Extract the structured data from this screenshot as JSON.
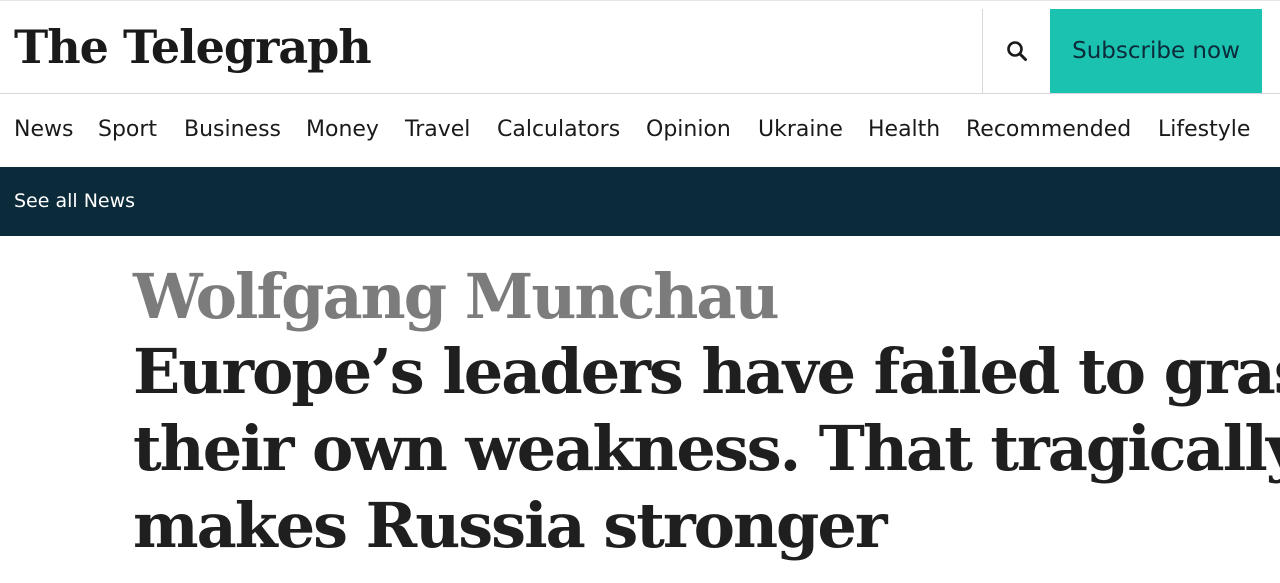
{
  "header": {
    "logo_text": "The Telegraph",
    "search_icon": "search-icon",
    "subscribe_label": "Subscribe now"
  },
  "nav": {
    "items": [
      {
        "label": "News"
      },
      {
        "label": "Sport"
      },
      {
        "label": "Business"
      },
      {
        "label": "Money"
      },
      {
        "label": "Travel"
      },
      {
        "label": "Calculators"
      },
      {
        "label": "Opinion"
      },
      {
        "label": "Ukraine"
      },
      {
        "label": "Health"
      },
      {
        "label": "Recommended"
      },
      {
        "label": "Lifestyle"
      }
    ]
  },
  "subnav": {
    "link_label": "See all News"
  },
  "article": {
    "author": "Wolfgang Munchau",
    "headline_lines": [
      "Europe’s leaders have failed to grasp",
      "their own weakness. That tragically",
      "makes Russia stronger"
    ]
  },
  "colors": {
    "accent": "#1bc2b0",
    "subnav_bg": "#0b2a3a",
    "author": "#7c7c7c",
    "headline": "#1f1f1f"
  }
}
